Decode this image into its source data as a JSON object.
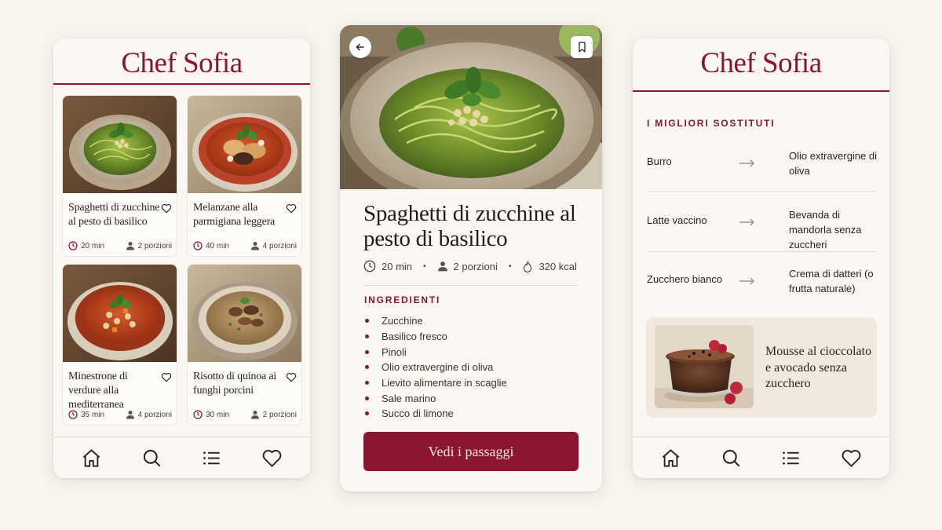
{
  "brand": "Chef Sofia",
  "accent_color": "#8a1530",
  "recipes": [
    {
      "title": "Spaghetti di zucchine al pesto di basilico",
      "time": "20 min",
      "servings": "2 porzioni"
    },
    {
      "title": "Melanzane alla parmigiana leggera",
      "time": "40 min",
      "servings": "4 porzioni"
    },
    {
      "title": "Minestrone di verdure alla mediterranea",
      "time": "35 min",
      "servings": "4 porzioni"
    },
    {
      "title": "Risotto di quinoa ai funghi porcini",
      "time": "30 min",
      "servings": "2 porzioni"
    }
  ],
  "tabbar": [
    "home-icon",
    "search-icon",
    "list-icon",
    "heart-icon"
  ],
  "detail": {
    "title": "Spaghetti di zucchine al pesto di basilico",
    "time": "20 min",
    "servings": "2 porzioni",
    "calories": "320 kcal",
    "ingredients_label": "INGREDIENTI",
    "ingredients": [
      "Zucchine",
      "Basilico fresco",
      "Pinoli",
      "Olio extravergine di oliva",
      "Lievito alimentare in scaglie",
      "Sale marino",
      "Succo di limone"
    ],
    "cta": "Vedi i passaggi"
  },
  "substitutes": {
    "label": "I MIGLIORI SOSTITUTI",
    "items": [
      {
        "from": "Burro",
        "to": "Olio extravergine di oliva"
      },
      {
        "from": "Latte vaccino",
        "to": "Bevanda di mandorla senza zuccheri"
      },
      {
        "from": "Zucchero bianco",
        "to": "Crema di datteri (o frutta naturale)"
      }
    ],
    "promo": "Mousse al cioccolato e avocado senza zucchero"
  }
}
